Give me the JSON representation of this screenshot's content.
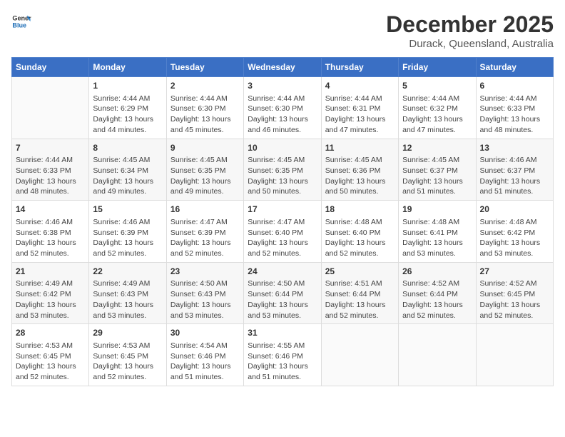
{
  "header": {
    "logo_general": "General",
    "logo_blue": "Blue",
    "month": "December 2025",
    "location": "Durack, Queensland, Australia"
  },
  "days_of_week": [
    "Sunday",
    "Monday",
    "Tuesday",
    "Wednesday",
    "Thursday",
    "Friday",
    "Saturday"
  ],
  "weeks": [
    [
      {
        "day": "",
        "content": ""
      },
      {
        "day": "1",
        "content": "Sunrise: 4:44 AM\nSunset: 6:29 PM\nDaylight: 13 hours\nand 44 minutes."
      },
      {
        "day": "2",
        "content": "Sunrise: 4:44 AM\nSunset: 6:30 PM\nDaylight: 13 hours\nand 45 minutes."
      },
      {
        "day": "3",
        "content": "Sunrise: 4:44 AM\nSunset: 6:30 PM\nDaylight: 13 hours\nand 46 minutes."
      },
      {
        "day": "4",
        "content": "Sunrise: 4:44 AM\nSunset: 6:31 PM\nDaylight: 13 hours\nand 47 minutes."
      },
      {
        "day": "5",
        "content": "Sunrise: 4:44 AM\nSunset: 6:32 PM\nDaylight: 13 hours\nand 47 minutes."
      },
      {
        "day": "6",
        "content": "Sunrise: 4:44 AM\nSunset: 6:33 PM\nDaylight: 13 hours\nand 48 minutes."
      }
    ],
    [
      {
        "day": "7",
        "content": "Sunrise: 4:44 AM\nSunset: 6:33 PM\nDaylight: 13 hours\nand 48 minutes."
      },
      {
        "day": "8",
        "content": "Sunrise: 4:45 AM\nSunset: 6:34 PM\nDaylight: 13 hours\nand 49 minutes."
      },
      {
        "day": "9",
        "content": "Sunrise: 4:45 AM\nSunset: 6:35 PM\nDaylight: 13 hours\nand 49 minutes."
      },
      {
        "day": "10",
        "content": "Sunrise: 4:45 AM\nSunset: 6:35 PM\nDaylight: 13 hours\nand 50 minutes."
      },
      {
        "day": "11",
        "content": "Sunrise: 4:45 AM\nSunset: 6:36 PM\nDaylight: 13 hours\nand 50 minutes."
      },
      {
        "day": "12",
        "content": "Sunrise: 4:45 AM\nSunset: 6:37 PM\nDaylight: 13 hours\nand 51 minutes."
      },
      {
        "day": "13",
        "content": "Sunrise: 4:46 AM\nSunset: 6:37 PM\nDaylight: 13 hours\nand 51 minutes."
      }
    ],
    [
      {
        "day": "14",
        "content": "Sunrise: 4:46 AM\nSunset: 6:38 PM\nDaylight: 13 hours\nand 52 minutes."
      },
      {
        "day": "15",
        "content": "Sunrise: 4:46 AM\nSunset: 6:39 PM\nDaylight: 13 hours\nand 52 minutes."
      },
      {
        "day": "16",
        "content": "Sunrise: 4:47 AM\nSunset: 6:39 PM\nDaylight: 13 hours\nand 52 minutes."
      },
      {
        "day": "17",
        "content": "Sunrise: 4:47 AM\nSunset: 6:40 PM\nDaylight: 13 hours\nand 52 minutes."
      },
      {
        "day": "18",
        "content": "Sunrise: 4:48 AM\nSunset: 6:40 PM\nDaylight: 13 hours\nand 52 minutes."
      },
      {
        "day": "19",
        "content": "Sunrise: 4:48 AM\nSunset: 6:41 PM\nDaylight: 13 hours\nand 53 minutes."
      },
      {
        "day": "20",
        "content": "Sunrise: 4:48 AM\nSunset: 6:42 PM\nDaylight: 13 hours\nand 53 minutes."
      }
    ],
    [
      {
        "day": "21",
        "content": "Sunrise: 4:49 AM\nSunset: 6:42 PM\nDaylight: 13 hours\nand 53 minutes."
      },
      {
        "day": "22",
        "content": "Sunrise: 4:49 AM\nSunset: 6:43 PM\nDaylight: 13 hours\nand 53 minutes."
      },
      {
        "day": "23",
        "content": "Sunrise: 4:50 AM\nSunset: 6:43 PM\nDaylight: 13 hours\nand 53 minutes."
      },
      {
        "day": "24",
        "content": "Sunrise: 4:50 AM\nSunset: 6:44 PM\nDaylight: 13 hours\nand 53 minutes."
      },
      {
        "day": "25",
        "content": "Sunrise: 4:51 AM\nSunset: 6:44 PM\nDaylight: 13 hours\nand 52 minutes."
      },
      {
        "day": "26",
        "content": "Sunrise: 4:52 AM\nSunset: 6:44 PM\nDaylight: 13 hours\nand 52 minutes."
      },
      {
        "day": "27",
        "content": "Sunrise: 4:52 AM\nSunset: 6:45 PM\nDaylight: 13 hours\nand 52 minutes."
      }
    ],
    [
      {
        "day": "28",
        "content": "Sunrise: 4:53 AM\nSunset: 6:45 PM\nDaylight: 13 hours\nand 52 minutes."
      },
      {
        "day": "29",
        "content": "Sunrise: 4:53 AM\nSunset: 6:45 PM\nDaylight: 13 hours\nand 52 minutes."
      },
      {
        "day": "30",
        "content": "Sunrise: 4:54 AM\nSunset: 6:46 PM\nDaylight: 13 hours\nand 51 minutes."
      },
      {
        "day": "31",
        "content": "Sunrise: 4:55 AM\nSunset: 6:46 PM\nDaylight: 13 hours\nand 51 minutes."
      },
      {
        "day": "",
        "content": ""
      },
      {
        "day": "",
        "content": ""
      },
      {
        "day": "",
        "content": ""
      }
    ]
  ]
}
